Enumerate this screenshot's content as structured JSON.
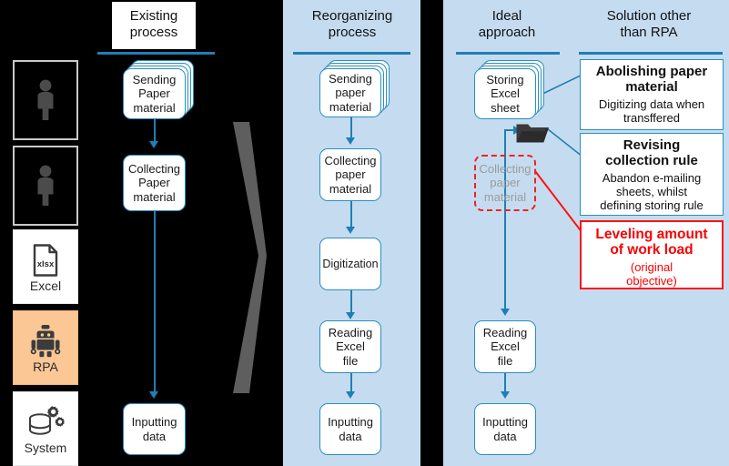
{
  "colors": {
    "panel_bg": "#c5dcf0",
    "page_bg": "#000000",
    "accent_blue": "#1f7fb5",
    "box_border": "#2a8fc0",
    "alert_red": "#ff1111",
    "rpa_highlight": "#fac795",
    "gray_arrow": "#5e5e5e"
  },
  "rail": {
    "items": [
      {
        "name": "person-icon-1",
        "label": "",
        "icon": "person-icon",
        "kind": "person"
      },
      {
        "name": "person-icon-2",
        "label": "",
        "icon": "person-icon",
        "kind": "person"
      },
      {
        "name": "excel",
        "label": "Excel",
        "icon": "excel-file-icon",
        "badge": "xlsx",
        "kind": "card"
      },
      {
        "name": "rpa",
        "label": "RPA",
        "icon": "robot-icon",
        "kind": "card-highlight"
      },
      {
        "name": "system",
        "label": "System",
        "icon": "database-gears-icon",
        "kind": "card"
      }
    ]
  },
  "columns": [
    {
      "id": "existing-process",
      "title_line1": "Existing",
      "title_line2": "process",
      "steps": [
        {
          "label_line1": "Sending",
          "label_line2": "Paper",
          "label_line3": "material",
          "stacked": true
        },
        {
          "label_line1": "Collecting",
          "label_line2": "Paper",
          "label_line3": "material",
          "stacked": false
        },
        {
          "label_line1": "Inputting",
          "label_line2": "data",
          "label_line3": "",
          "stacked": false
        }
      ]
    },
    {
      "id": "reorganizing-process",
      "title_line1": "Reorganizing",
      "title_line2": "process",
      "steps": [
        {
          "label_line1": "Sending",
          "label_line2": "paper",
          "label_line3": "material",
          "stacked": true
        },
        {
          "label_line1": "Collecting",
          "label_line2": "paper",
          "label_line3": "material",
          "stacked": false
        },
        {
          "label_line1": "Digitization",
          "label_line2": "",
          "label_line3": "",
          "stacked": false
        },
        {
          "label_line1": "Reading",
          "label_line2": "Excel",
          "label_line3": "file",
          "stacked": false
        },
        {
          "label_line1": "Inputting",
          "label_line2": "data",
          "label_line3": "",
          "stacked": false
        }
      ]
    },
    {
      "id": "ideal-approach",
      "title_line1": "Ideal",
      "title_line2": "approach",
      "steps": [
        {
          "label_line1": "Storing",
          "label_line2": "Excel",
          "label_line3": "sheet",
          "stacked": true
        },
        {
          "label_line1": "Collecting",
          "label_line2": "paper",
          "label_line3": "material",
          "stacked": false,
          "removed": true
        },
        {
          "label_line1": "Reading",
          "label_line2": "Excel",
          "label_line3": "file",
          "stacked": false
        },
        {
          "label_line1": "Inputting",
          "label_line2": "data",
          "label_line3": "",
          "stacked": false
        }
      ]
    }
  ],
  "solution_column": {
    "title_line1": "Solution other",
    "title_line2": "than RPA",
    "callouts": [
      {
        "id": "abolishing-paper-material",
        "heading_line1": "Abolishing paper",
        "heading_line2": "material",
        "sub_line1": "Digitizing data when",
        "sub_line2": "transffered",
        "style": "blue"
      },
      {
        "id": "revising-collection-rule",
        "heading_line1": "Revising",
        "heading_line2": "collection rule",
        "sub_line1": "Abandon e-mailing",
        "sub_line2": "sheets, whilst",
        "sub_line3": "defining storing rule",
        "style": "blue"
      },
      {
        "id": "leveling-amount-of-work-load",
        "heading_line1": "Leveling amount",
        "heading_line2": "of work load",
        "sub_line1": "(original",
        "sub_line2": "objective)",
        "style": "red"
      }
    ]
  },
  "decorations": {
    "gray_arrow_name": "transformation-arrow",
    "folder_name": "folder-icon"
  }
}
